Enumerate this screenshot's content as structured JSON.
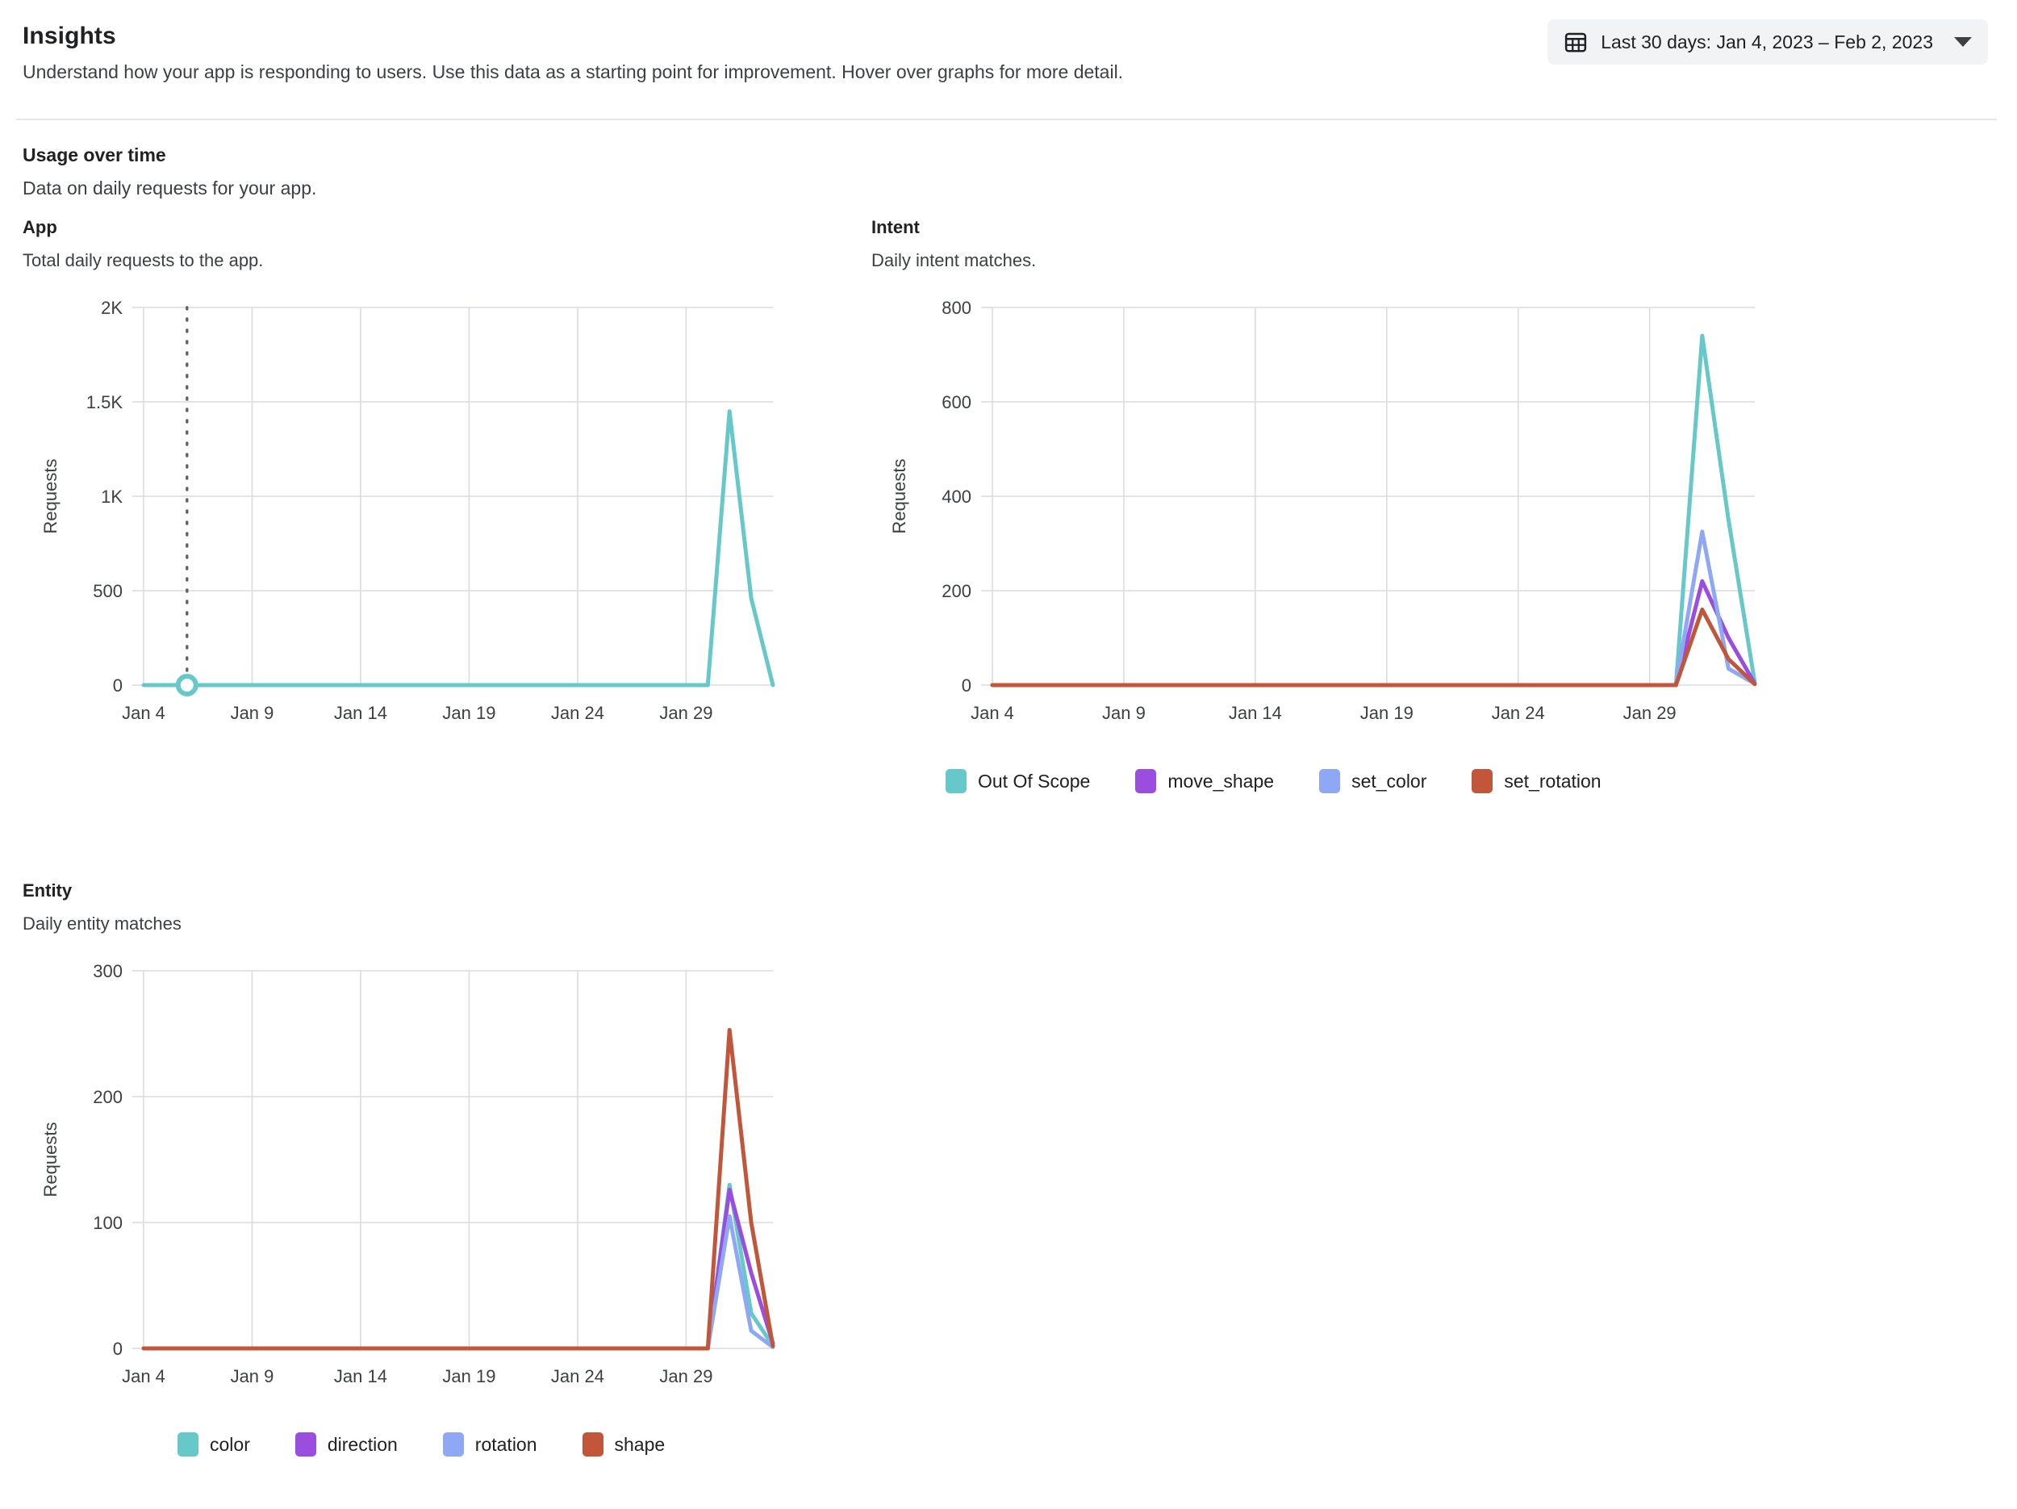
{
  "header": {
    "title": "Insights",
    "subtitle": "Understand how your app is responding to users. Use this data as a starting point for improvement. Hover over graphs for more detail.",
    "date_picker": {
      "label": "Last 30 days: Jan 4, 2023 – Feb 2, 2023",
      "calendar_icon": "calendar-icon",
      "caret_icon": "chevron-down-icon"
    }
  },
  "section": {
    "title": "Usage over time",
    "subtitle": "Data on daily requests for your app."
  },
  "palette": {
    "teal": "#66C8C8",
    "purple": "#9B4DE0",
    "periwinkle": "#8FA8F5",
    "terracotta": "#C1563A",
    "grid": "#dadce0",
    "axis_text": "#3c4043"
  },
  "charts": {
    "app": {
      "title": "App",
      "subtitle": "Total daily requests to the app.",
      "hover_marker_date": "Jan 6"
    },
    "intent": {
      "title": "Intent",
      "subtitle": "Daily intent matches."
    },
    "entity": {
      "title": "Entity",
      "subtitle": "Daily entity matches"
    }
  },
  "chart_data": [
    {
      "id": "app",
      "type": "line",
      "title": "App",
      "subtitle": "Total daily requests to the app.",
      "xlabel": "",
      "ylabel": "Requests",
      "ylim": [
        0,
        2000
      ],
      "yticks": [
        0,
        500,
        1000,
        1500,
        2000
      ],
      "ytick_labels": [
        "0",
        "500",
        "1K",
        "1.5K",
        "2K"
      ],
      "xticks": [
        "Jan 4",
        "Jan 9",
        "Jan 14",
        "Jan 19",
        "Jan 24",
        "Jan 29"
      ],
      "x": [
        "Jan 4",
        "Jan 5",
        "Jan 6",
        "Jan 7",
        "Jan 8",
        "Jan 9",
        "Jan 10",
        "Jan 11",
        "Jan 12",
        "Jan 13",
        "Jan 14",
        "Jan 15",
        "Jan 16",
        "Jan 17",
        "Jan 18",
        "Jan 19",
        "Jan 20",
        "Jan 21",
        "Jan 22",
        "Jan 23",
        "Jan 24",
        "Jan 25",
        "Jan 26",
        "Jan 27",
        "Jan 28",
        "Jan 29",
        "Jan 30",
        "Jan 31",
        "Feb 1",
        "Feb 2"
      ],
      "grid": true,
      "legend": null,
      "series": [
        {
          "name": "Requests",
          "color": "#66C8C8",
          "values": [
            0,
            0,
            0,
            0,
            0,
            0,
            0,
            0,
            0,
            0,
            0,
            0,
            0,
            0,
            0,
            0,
            0,
            0,
            0,
            0,
            0,
            0,
            0,
            0,
            0,
            0,
            0,
            1450,
            460,
            0
          ]
        }
      ],
      "annotations": [
        {
          "type": "hover-line",
          "x": "Jan 6",
          "y": 0,
          "style": "dotted",
          "marker": "circle"
        }
      ]
    },
    {
      "id": "intent",
      "type": "line",
      "title": "Intent",
      "subtitle": "Daily intent matches.",
      "xlabel": "",
      "ylabel": "Requests",
      "ylim": [
        0,
        800
      ],
      "yticks": [
        0,
        200,
        400,
        600,
        800
      ],
      "ytick_labels": [
        "0",
        "200",
        "400",
        "600",
        "800"
      ],
      "xticks": [
        "Jan 4",
        "Jan 9",
        "Jan 14",
        "Jan 19",
        "Jan 24",
        "Jan 29"
      ],
      "x": [
        "Jan 4",
        "Jan 5",
        "Jan 6",
        "Jan 7",
        "Jan 8",
        "Jan 9",
        "Jan 10",
        "Jan 11",
        "Jan 12",
        "Jan 13",
        "Jan 14",
        "Jan 15",
        "Jan 16",
        "Jan 17",
        "Jan 18",
        "Jan 19",
        "Jan 20",
        "Jan 21",
        "Jan 22",
        "Jan 23",
        "Jan 24",
        "Jan 25",
        "Jan 26",
        "Jan 27",
        "Jan 28",
        "Jan 29",
        "Jan 30",
        "Jan 31",
        "Feb 1",
        "Feb 2"
      ],
      "grid": true,
      "legend": {
        "position": "bottom"
      },
      "series": [
        {
          "name": "Out Of Scope",
          "color": "#66C8C8",
          "values": [
            0,
            0,
            0,
            0,
            0,
            0,
            0,
            0,
            0,
            0,
            0,
            0,
            0,
            0,
            0,
            0,
            0,
            0,
            0,
            0,
            0,
            0,
            0,
            0,
            0,
            0,
            0,
            740,
            350,
            5
          ]
        },
        {
          "name": "move_shape",
          "color": "#9B4DE0",
          "values": [
            0,
            0,
            0,
            0,
            0,
            0,
            0,
            0,
            0,
            0,
            0,
            0,
            0,
            0,
            0,
            0,
            0,
            0,
            0,
            0,
            0,
            0,
            0,
            0,
            0,
            0,
            0,
            220,
            100,
            3
          ]
        },
        {
          "name": "set_color",
          "color": "#8FA8F5",
          "values": [
            0,
            0,
            0,
            0,
            0,
            0,
            0,
            0,
            0,
            0,
            0,
            0,
            0,
            0,
            0,
            0,
            0,
            0,
            0,
            0,
            0,
            0,
            0,
            0,
            0,
            0,
            0,
            325,
            35,
            3
          ]
        },
        {
          "name": "set_rotation",
          "color": "#C1563A",
          "values": [
            0,
            0,
            0,
            0,
            0,
            0,
            0,
            0,
            0,
            0,
            0,
            0,
            0,
            0,
            0,
            0,
            0,
            0,
            0,
            0,
            0,
            0,
            0,
            0,
            0,
            0,
            0,
            160,
            55,
            2
          ]
        }
      ]
    },
    {
      "id": "entity",
      "type": "line",
      "title": "Entity",
      "subtitle": "Daily entity matches",
      "xlabel": "",
      "ylabel": "Requests",
      "ylim": [
        0,
        300
      ],
      "yticks": [
        0,
        100,
        200,
        300
      ],
      "ytick_labels": [
        "0",
        "100",
        "200",
        "300"
      ],
      "xticks": [
        "Jan 4",
        "Jan 9",
        "Jan 14",
        "Jan 19",
        "Jan 24",
        "Jan 29"
      ],
      "x": [
        "Jan 4",
        "Jan 5",
        "Jan 6",
        "Jan 7",
        "Jan 8",
        "Jan 9",
        "Jan 10",
        "Jan 11",
        "Jan 12",
        "Jan 13",
        "Jan 14",
        "Jan 15",
        "Jan 16",
        "Jan 17",
        "Jan 18",
        "Jan 19",
        "Jan 20",
        "Jan 21",
        "Jan 22",
        "Jan 23",
        "Jan 24",
        "Jan 25",
        "Jan 26",
        "Jan 27",
        "Jan 28",
        "Jan 29",
        "Jan 30",
        "Jan 31",
        "Feb 1",
        "Feb 2"
      ],
      "grid": true,
      "legend": {
        "position": "bottom"
      },
      "series": [
        {
          "name": "color",
          "color": "#66C8C8",
          "values": [
            0,
            0,
            0,
            0,
            0,
            0,
            0,
            0,
            0,
            0,
            0,
            0,
            0,
            0,
            0,
            0,
            0,
            0,
            0,
            0,
            0,
            0,
            0,
            0,
            0,
            0,
            0,
            130,
            28,
            2
          ]
        },
        {
          "name": "direction",
          "color": "#9B4DE0",
          "values": [
            0,
            0,
            0,
            0,
            0,
            0,
            0,
            0,
            0,
            0,
            0,
            0,
            0,
            0,
            0,
            0,
            0,
            0,
            0,
            0,
            0,
            0,
            0,
            0,
            0,
            0,
            0,
            126,
            60,
            4
          ]
        },
        {
          "name": "rotation",
          "color": "#8FA8F5",
          "values": [
            0,
            0,
            0,
            0,
            0,
            0,
            0,
            0,
            0,
            0,
            0,
            0,
            0,
            0,
            0,
            0,
            0,
            0,
            0,
            0,
            0,
            0,
            0,
            0,
            0,
            0,
            0,
            105,
            14,
            1
          ]
        },
        {
          "name": "shape",
          "color": "#C1563A",
          "values": [
            0,
            0,
            0,
            0,
            0,
            0,
            0,
            0,
            0,
            0,
            0,
            0,
            0,
            0,
            0,
            0,
            0,
            0,
            0,
            0,
            0,
            0,
            0,
            0,
            0,
            0,
            0,
            253,
            100,
            2
          ]
        }
      ]
    }
  ]
}
